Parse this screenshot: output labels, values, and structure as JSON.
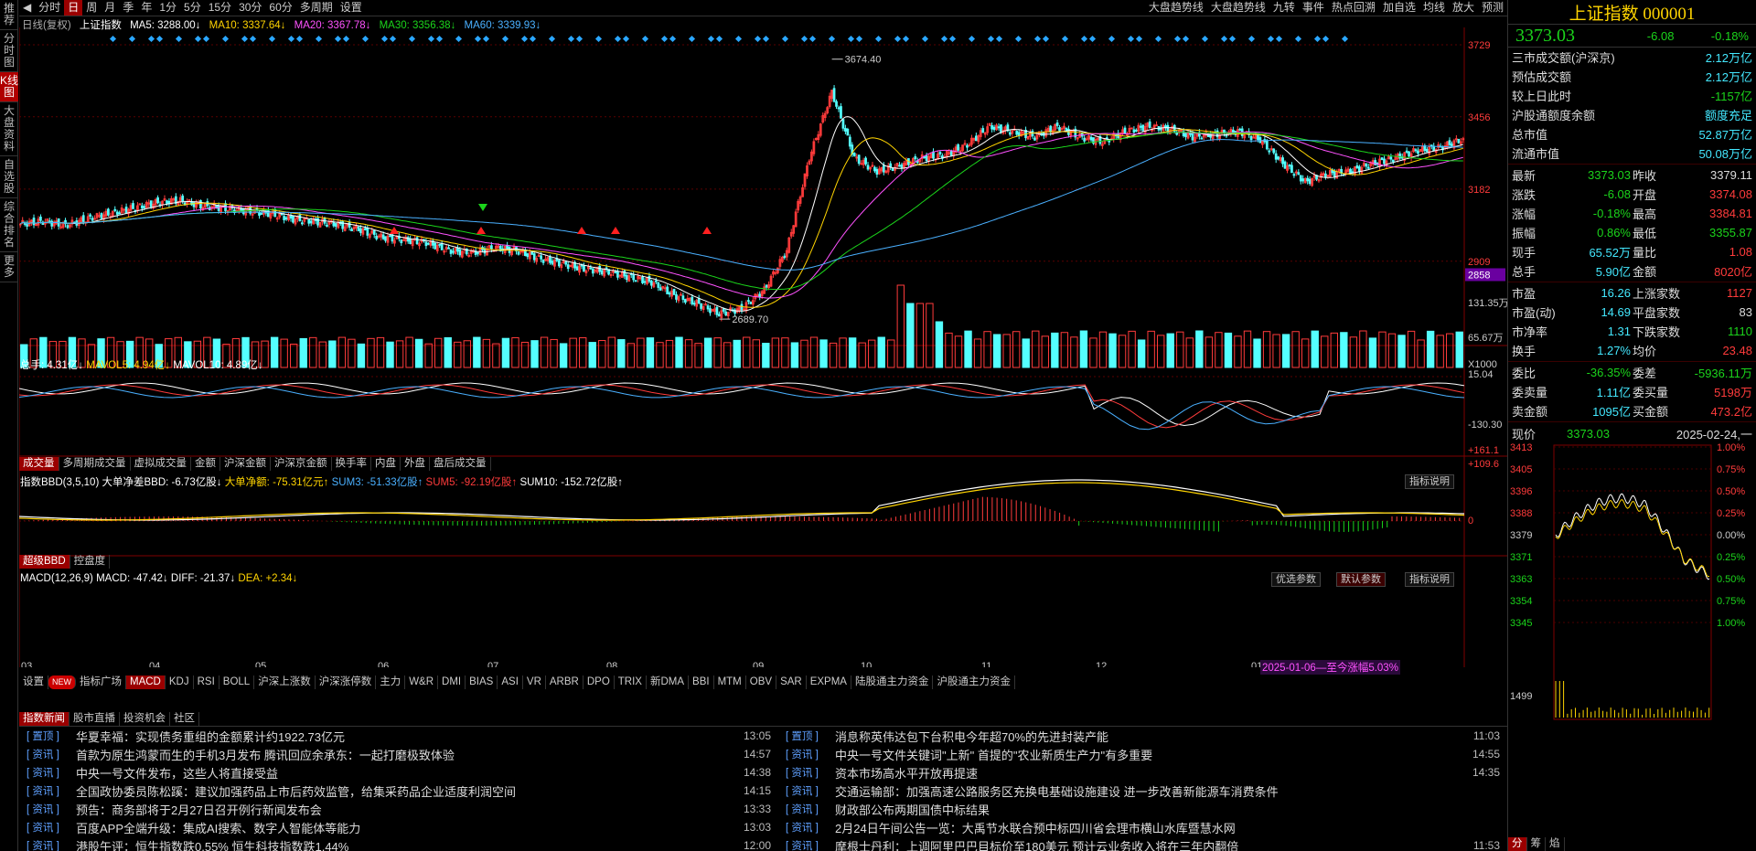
{
  "vertical_tabs": [
    "推荐",
    "分时图",
    "K线图",
    "大盘资料",
    "自选股",
    "综合排名",
    "更多"
  ],
  "topbar": {
    "periods": [
      "分时",
      "日",
      "周",
      "月",
      "季",
      "年",
      "1分",
      "5分",
      "15分",
      "30分",
      "60分",
      "多周期",
      "设置"
    ],
    "selected_period": "日",
    "right_items": [
      "大盘趋势线",
      "大盘趋势线",
      "九转",
      "事件",
      "热点回溯",
      "加自选",
      "均线",
      "放大",
      "预测"
    ]
  },
  "kline": {
    "title": "日线(复权)",
    "index_name": "上证指数",
    "ma5": "MA5: 3288.00↓",
    "ma10": "MA10: 3337.64↓",
    "ma20": "MA20: 3367.78↓",
    "ma30": "MA30: 3356.38↓",
    "ma60": "MA60: 3339.93↓",
    "axis": [
      "3729",
      "3456",
      "3182",
      "2909"
    ],
    "current_label": "2858",
    "high_label": "3674.40",
    "low_label": "2689.70"
  },
  "volume": {
    "header_total": "总手: 4.31亿↓",
    "header_mavol5": "MAVOL5: 4.94亿↓",
    "header_mavol10": "MAVOL10: 4.89亿↓",
    "axis": [
      "131.35万",
      "65.67万",
      "X1000"
    ],
    "tabs": [
      "成交量",
      "多周期成交量",
      "虚拟成交量",
      "金额",
      "沪深金额",
      "沪深京金额",
      "换手率",
      "内盘",
      "外盘",
      "盘后成交量"
    ]
  },
  "bbd": {
    "header_a": "指数BBD(3,5,10) 大单净差BBD: -6.73亿股↓",
    "header_b": "大单净额: -75.31亿元↑",
    "header_c": "SUM3: -51.33亿股↑",
    "header_d": "SUM5: -92.19亿股↑",
    "header_e": "SUM10: -152.72亿股↑",
    "help": "指标说明",
    "axis": [
      "15.04",
      "-130.30"
    ],
    "tabs": [
      "超级BBD",
      "控盘度"
    ]
  },
  "macd": {
    "header_a": "MACD(12,26,9) MACD: -47.42↓",
    "header_b": "DIFF: -21.37↓",
    "header_c": "DEA: +2.34↓",
    "btn_opt": "优选参数",
    "btn_default": "默认参数",
    "btn_help": "指标说明",
    "axis": [
      "+161.1",
      "+109.6",
      "0"
    ],
    "months": [
      "03",
      "04",
      "05",
      "06",
      "07",
      "08",
      "09",
      "10",
      "11",
      "12",
      "01"
    ],
    "range_label": "2025-01-06—至今涨幅5.03%"
  },
  "indicator_tabs": [
    "设置",
    "NEW",
    "指标广场",
    "MACD",
    "KDJ",
    "RSI",
    "BOLL",
    "沪深上涨数",
    "沪深涨停数",
    "主力",
    "W&R",
    "DMI",
    "BIAS",
    "ASI",
    "VR",
    "ARBR",
    "DPO",
    "TRIX",
    "新DMA",
    "BBI",
    "MTM",
    "OBV",
    "SAR",
    "EXPMA",
    "陆股通主力资金",
    "沪股通主力资金"
  ],
  "news": {
    "tabs": [
      "指数新闻",
      "股市直播",
      "投资机会",
      "社区"
    ],
    "left": [
      {
        "tag": "[ 置顶 ]",
        "title": "华夏幸福：实现债务重组的金额累计约1922.73亿元",
        "time": "13:05"
      },
      {
        "tag": "[ 资讯 ]",
        "title": "首款为原生鸿蒙而生的手机3月发布 腾讯回应余承东：一起打磨极致体验",
        "time": "14:57"
      },
      {
        "tag": "[ 资讯 ]",
        "title": "中央一号文件发布，这些人将直接受益",
        "time": "14:38"
      },
      {
        "tag": "[ 资讯 ]",
        "title": "全国政协委员陈松蹊：建议加强药品上市后药效监管，给集采药品企业适度利润空间",
        "time": "14:15"
      },
      {
        "tag": "[ 资讯 ]",
        "title": "预告：商务部将于2月27日召开例行新闻发布会",
        "time": "13:33"
      },
      {
        "tag": "[ 资讯 ]",
        "title": "百度APP全端升级：集成AI搜索、数字人智能体等能力",
        "time": "13:03"
      },
      {
        "tag": "[ 资讯 ]",
        "title": "港股午评：恒生指数跌0.55% 恒生科技指数跌1.44%",
        "time": "12:00"
      }
    ],
    "right": [
      {
        "tag": "[ 置顶 ]",
        "title": "消息称英伟达包下台积电今年超70%的先进封装产能",
        "time": "11:03"
      },
      {
        "tag": "[ 资讯 ]",
        "title": "中央一号文件关键词\"上新\" 首提的\"农业新质生产力\"有多重要",
        "time": "14:55"
      },
      {
        "tag": "[ 资讯 ]",
        "title": "资本市场高水平开放再提速",
        "time": "14:35"
      },
      {
        "tag": "[ 资讯 ]",
        "title": "交通运输部：加强高速公路服务区充换电基础设施建设 进一步改善新能源车消费条件",
        "time": ""
      },
      {
        "tag": "[ 资讯 ]",
        "title": "财政部公布两期国债中标结果",
        "time": ""
      },
      {
        "tag": "[ 资讯 ]",
        "title": "2月24日午间公告一览：大禹节水联合预中标四川省会理市横山水库暨慧水网",
        "time": ""
      },
      {
        "tag": "[ 资讯 ]",
        "title": "摩根士丹利：上调阿里巴巴目标价至180美元 预计云业务收入将在三年内翻倍",
        "time": "11:53"
      }
    ]
  },
  "quote": {
    "name": "上证指数",
    "code": "000001",
    "price": "3373.03",
    "change": "-6.08",
    "pct": "-0.18%",
    "rows1": [
      {
        "l": "三市成交额(沪深京)",
        "v": "2.12万亿"
      },
      {
        "l": "预估成交额",
        "v": "2.12万亿"
      },
      {
        "l": "较上日此时",
        "v": "-1157亿"
      },
      {
        "l": "沪股通额度余额",
        "v": "额度充足"
      },
      {
        "l": "总市值",
        "v": "52.87万亿"
      },
      {
        "l": "流通市值",
        "v": "50.08万亿"
      }
    ],
    "rows2": [
      {
        "l1": "最新",
        "v1": "3373.03",
        "l2": "昨收",
        "v2": "3379.11"
      },
      {
        "l1": "涨跌",
        "v1": "-6.08",
        "l2": "开盘",
        "v2": "3374.08"
      },
      {
        "l1": "涨幅",
        "v1": "-0.18%",
        "l2": "最高",
        "v2": "3384.81"
      },
      {
        "l1": "振幅",
        "v1": "0.86%",
        "l2": "最低",
        "v2": "3355.87"
      },
      {
        "l1": "现手",
        "v1": "65.52万",
        "l2": "量比",
        "v2": "1.08"
      },
      {
        "l1": "总手",
        "v1": "5.90亿",
        "l2": "金额",
        "v2": "8020亿"
      }
    ],
    "rows3": [
      {
        "l1": "市盈",
        "v1": "16.26",
        "l2": "上涨家数",
        "v2": "1127"
      },
      {
        "l1": "市盈(动)",
        "v1": "14.69",
        "l2": "平盘家数",
        "v2": "83"
      },
      {
        "l1": "市净率",
        "v1": "1.31",
        "l2": "下跌家数",
        "v2": "1110"
      },
      {
        "l1": "换手",
        "v1": "1.27%",
        "l2": "均价",
        "v2": "23.48"
      }
    ],
    "rows4": [
      {
        "l1": "委比",
        "v1": "-36.35%",
        "l2": "委差",
        "v2": "-5936.11万"
      },
      {
        "l1": "委卖量",
        "v1": "1.11亿",
        "l2": "委买量",
        "v2": "5198万"
      },
      {
        "l1": "卖金额",
        "v1": "1095亿",
        "l2": "买金额",
        "v2": "473.2亿"
      }
    ],
    "now_label": "现价",
    "now_value": "3373.03",
    "date": "2025-02-24,一",
    "mini_left": [
      "3413",
      "3405",
      "3396",
      "3388",
      "3379",
      "3371",
      "3363",
      "3354",
      "3345",
      "1499"
    ],
    "mini_right": [
      "1.00%",
      "0.75%",
      "0.50%",
      "0.25%",
      "0.00%",
      "0.25%",
      "0.50%",
      "0.75%",
      "1.00%"
    ],
    "bottom_tabs": [
      "分",
      "筹",
      "焰"
    ]
  },
  "chart_data": {
    "type": "candlestick",
    "title": "上证指数 日线(复权)",
    "x_months": [
      "03",
      "04",
      "05",
      "06",
      "07",
      "08",
      "09",
      "10",
      "11",
      "12",
      "01"
    ],
    "ylim": [
      2689.7,
      3729
    ],
    "annotated_high": 3674.4,
    "annotated_low": 2689.7,
    "close_path": [
      3050,
      3060,
      3045,
      3070,
      3090,
      3110,
      3130,
      3140,
      3120,
      3110,
      3100,
      3090,
      3070,
      3060,
      3050,
      3030,
      3000,
      2990,
      2980,
      2950,
      2940,
      2960,
      2950,
      2920,
      2900,
      2880,
      2870,
      2850,
      2830,
      2780,
      2750,
      2710,
      2730,
      2800,
      2950,
      3300,
      3550,
      3300,
      3250,
      3270,
      3300,
      3310,
      3350,
      3420,
      3400,
      3380,
      3420,
      3380,
      3360,
      3400,
      3420,
      3410,
      3380,
      3390,
      3400,
      3370,
      3280,
      3210,
      3240,
      3250,
      3280,
      3300,
      3330,
      3340,
      3373
    ]
  }
}
